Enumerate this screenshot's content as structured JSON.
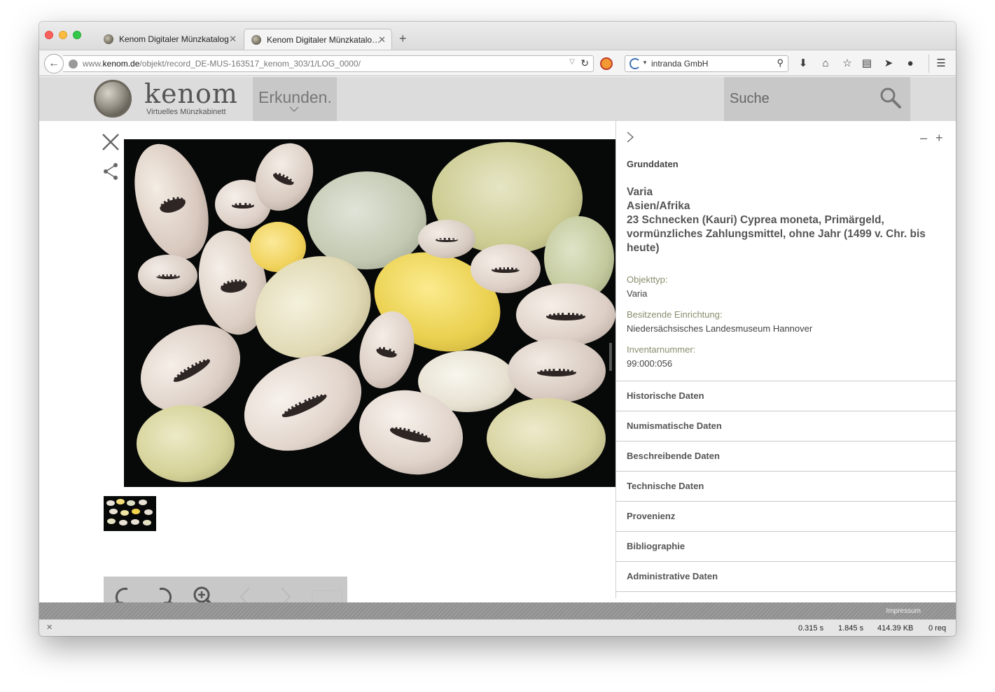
{
  "browser": {
    "tabs": [
      {
        "label": "Kenom Digitaler Münzkatalog",
        "close": "✕"
      },
      {
        "label": "Kenom Digitaler Münzkatalo…",
        "close": "✕"
      }
    ],
    "new_tab": "+",
    "url": {
      "prefix": "www.",
      "domain": "kenom.de",
      "path": "/objekt/record_DE-MUS-163517_kenom_303/1/LOG_0000/"
    },
    "search_engine_text": "intranda GmbH"
  },
  "site": {
    "logo_title": "kenom",
    "logo_subtitle": "Virtuelles Münzkabinett",
    "nav_explore": "Erkunden.",
    "search_placeholder": "Suche",
    "footer_link": "Impressum"
  },
  "panel": {
    "heading": "Grunddaten",
    "title_lines": [
      "Varia",
      "Asien/Afrika",
      "23 Schnecken (Kauri) Cyprea moneta, Primärgeld, vormünzliches Zahlungsmittel, ohne Jahr (1499 v. Chr. bis heute)"
    ],
    "fields": [
      {
        "label": "Objekttyp:",
        "value": "Varia"
      },
      {
        "label": "Besitzende Einrichtung:",
        "value": "Niedersächsisches Landesmuseum Hannover"
      },
      {
        "label": "Inventarnummer:",
        "value": "99:000:056"
      }
    ],
    "sections": [
      "Historische Daten",
      "Numismatische Daten",
      "Beschreibende Daten",
      "Technische Daten",
      "Provenienz",
      "Bibliographie",
      "Administrative Daten"
    ],
    "minus": "–",
    "plus": "+"
  },
  "status": {
    "values": [
      "0.315 s",
      "1.845 s",
      "414.39 KB",
      "0 req"
    ]
  },
  "colors": {
    "header_bg": "#dcdcdc",
    "nav_block": "#c8c8c8",
    "field_label": "#8a8d6e",
    "image_bg": "#070808"
  }
}
